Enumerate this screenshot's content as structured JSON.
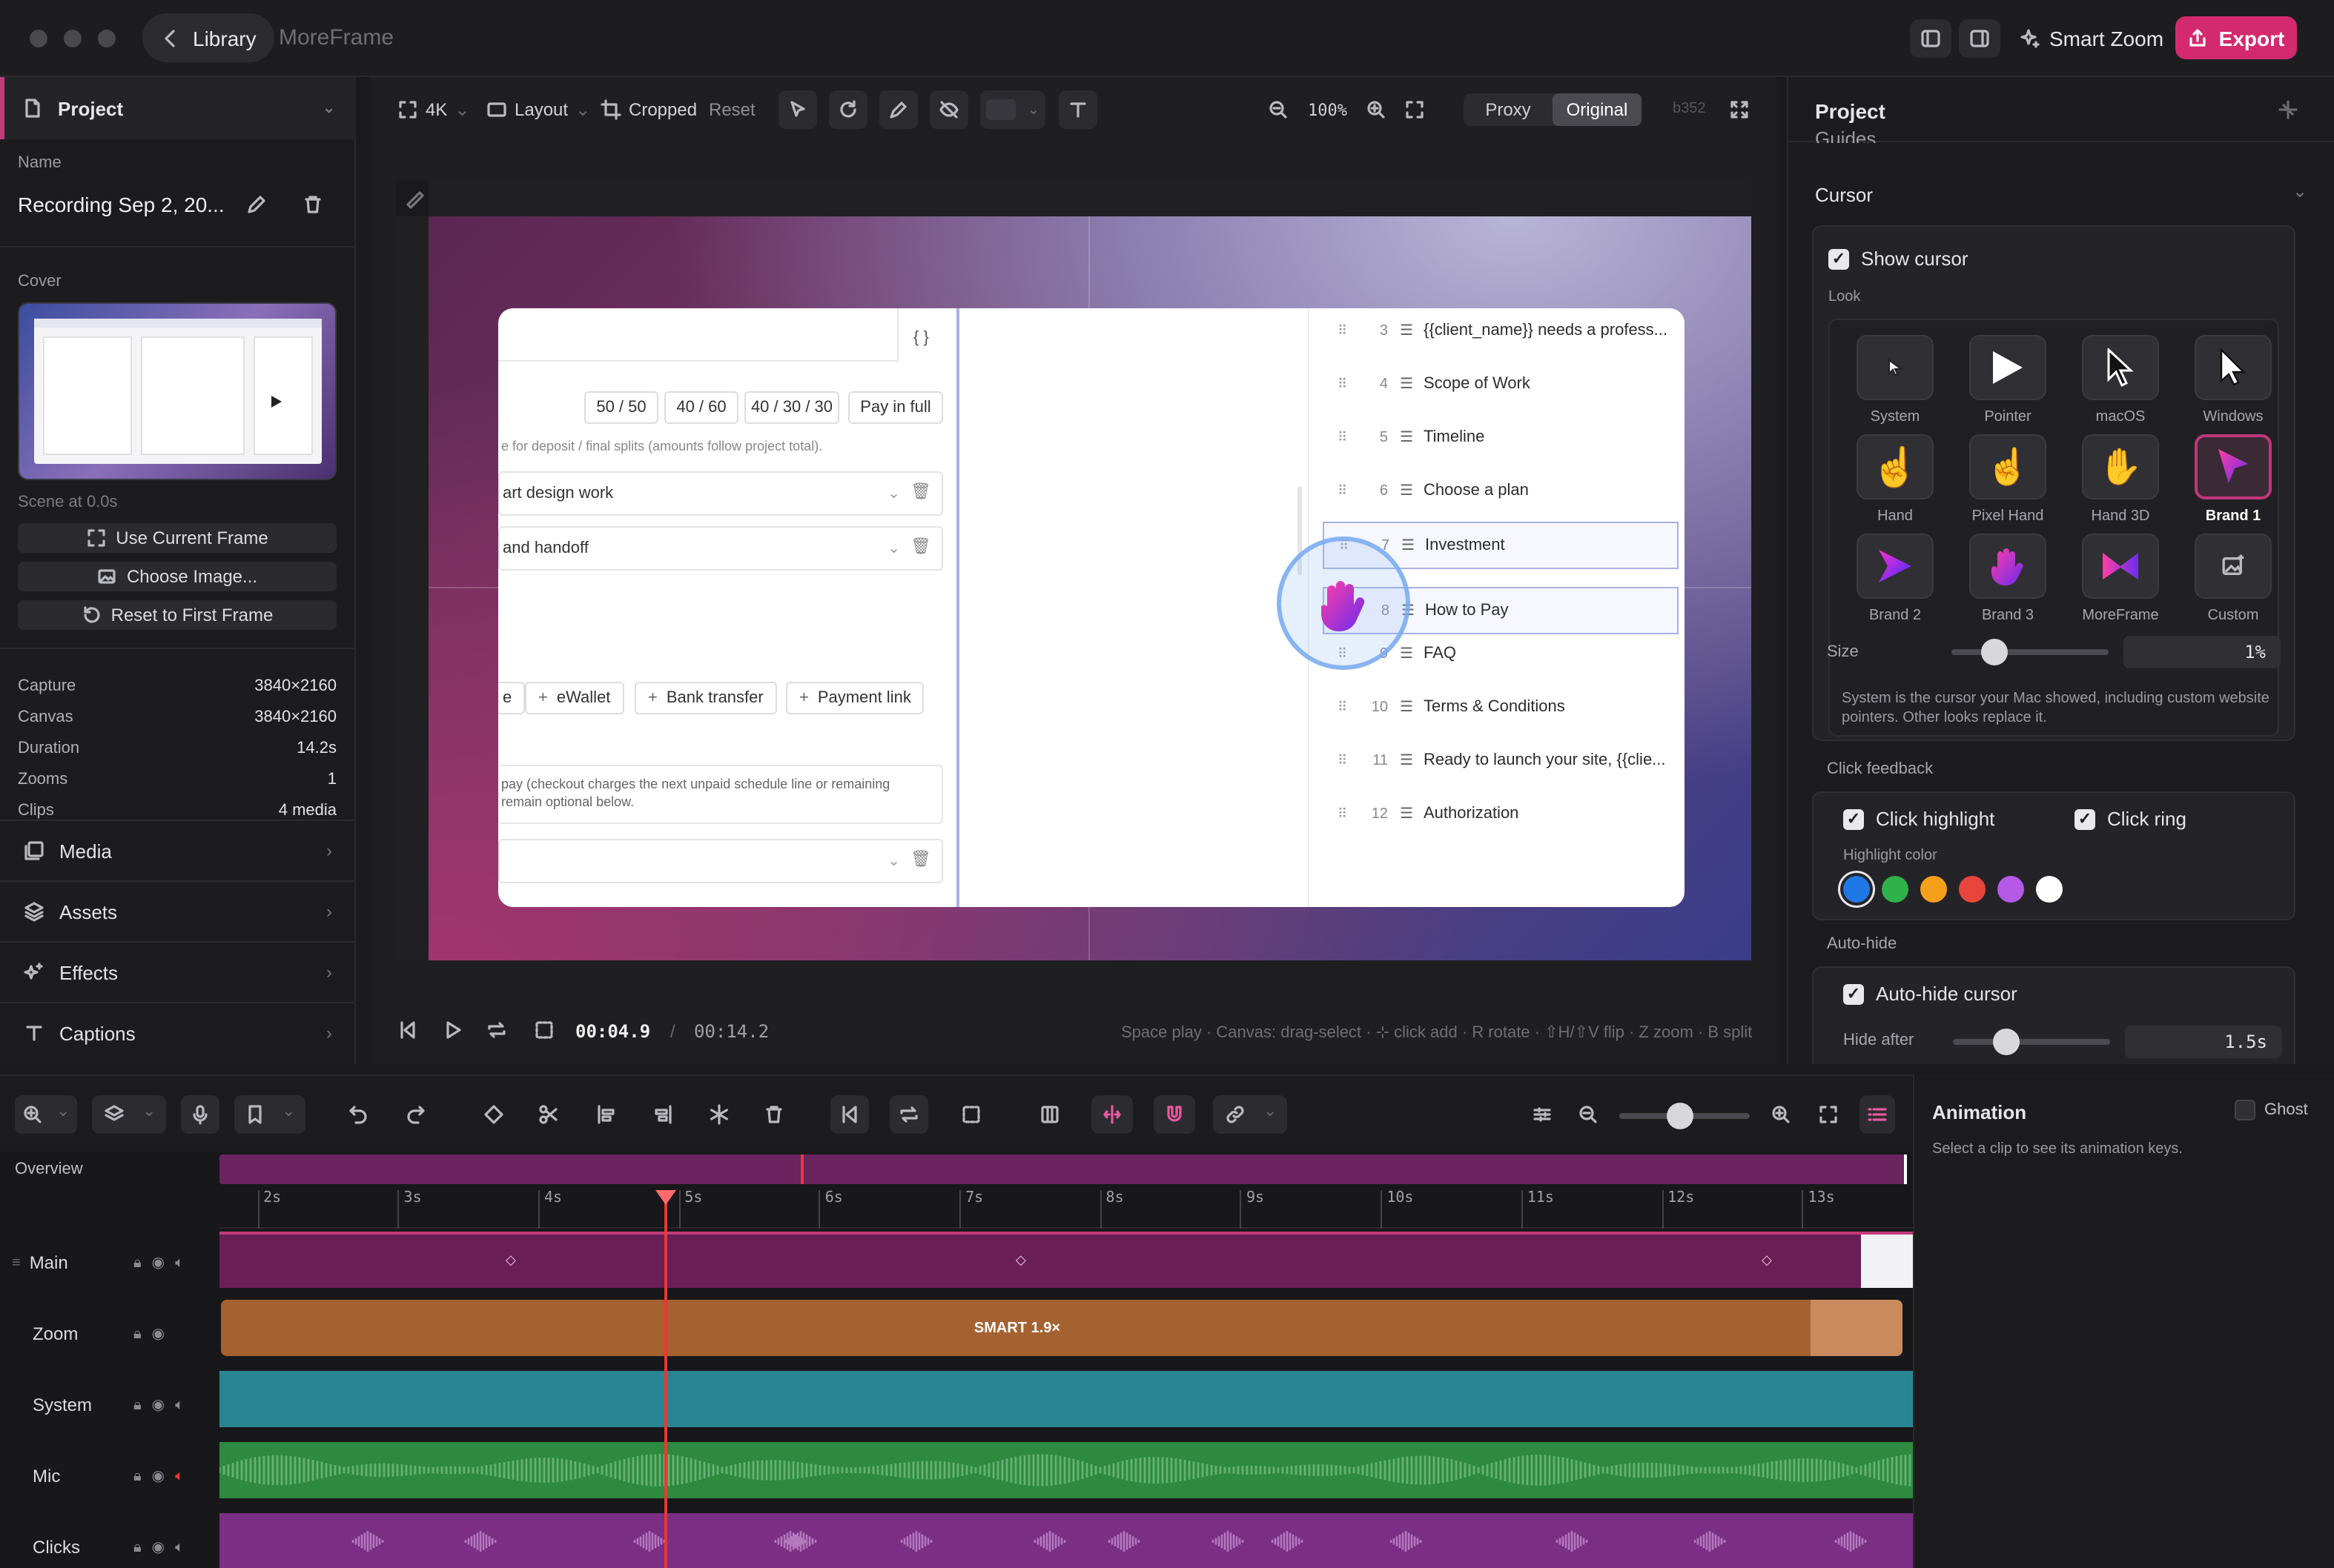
{
  "titlebar": {
    "back_label": "Library",
    "app_name": "MoreFrame",
    "smart_zoom": "Smart Zoom",
    "export": "Export"
  },
  "left": {
    "project_title": "Project",
    "name_label": "Name",
    "name_value": "Recording Sep 2, 20...",
    "cover_label": "Cover",
    "scene_at": "Scene at 0.0s",
    "use_current": "Use Current Frame",
    "choose_image": "Choose Image...",
    "reset_first": "Reset to First Frame",
    "stats": [
      {
        "k": "Capture",
        "v": "3840×2160"
      },
      {
        "k": "Canvas",
        "v": "3840×2160"
      },
      {
        "k": "Duration",
        "v": "14.2s"
      },
      {
        "k": "Zooms",
        "v": "1"
      },
      {
        "k": "Clips",
        "v": "4 media"
      }
    ],
    "sections": [
      "Media",
      "Assets",
      "Effects",
      "Captions"
    ]
  },
  "canvas_toolbar": {
    "resolution": "4K",
    "layout": "Layout",
    "cropped": "Cropped",
    "reset": "Reset",
    "zoom": "100%",
    "proxy": "Proxy",
    "original": "Original",
    "build": "b352"
  },
  "mock": {
    "braces": "{ }",
    "splits": [
      "50 / 50",
      "40 / 60",
      "40 / 30 / 30",
      "Pay in full"
    ],
    "deposit_note": "e for deposit / final splits (amounts follow project total).",
    "field1": "art design work",
    "field2": "and handoff",
    "methods": [
      "e",
      "eWallet",
      "Bank transfer",
      "Payment link"
    ],
    "pay_note_1": "pay (checkout charges the next unpaid schedule line or remaining",
    "pay_note_2": "remain optional below.",
    "sections": [
      {
        "n": "3",
        "t": "{{client_name}} needs a profess..."
      },
      {
        "n": "4",
        "t": "Scope of Work"
      },
      {
        "n": "5",
        "t": "Timeline"
      },
      {
        "n": "6",
        "t": "Choose a plan"
      },
      {
        "n": "7",
        "t": "Investment"
      },
      {
        "n": "8",
        "t": "How to Pay"
      },
      {
        "n": "9",
        "t": "FAQ"
      },
      {
        "n": "10",
        "t": "Terms & Conditions"
      },
      {
        "n": "11",
        "t": "Ready to launch your site, {{clie..."
      },
      {
        "n": "12",
        "t": "Authorization"
      }
    ]
  },
  "playback": {
    "current": "00:04.9",
    "sep": "/",
    "total": "00:14.2",
    "hints": "Space play · Canvas: drag-select · ⊹ click add · R rotate · ⇧H/⇧V flip · Z zoom · B split"
  },
  "right": {
    "title": "Project",
    "guides": "Guides",
    "cursor": "Cursor",
    "show_cursor": "Show cursor",
    "look": "Look",
    "looks": [
      "System",
      "Pointer",
      "macOS",
      "Windows",
      "Hand",
      "Pixel Hand",
      "Hand 3D",
      "Brand 1",
      "Brand 2",
      "Brand 3",
      "MoreFrame",
      "Custom"
    ],
    "selected_look": "Brand 1",
    "size_label": "Size",
    "size_value": "1%",
    "size_level": 0.27,
    "system_note": "System is the cursor your Mac showed, including custom website pointers. Other looks replace it.",
    "click_feedback": "Click feedback",
    "click_highlight": "Click highlight",
    "click_ring": "Click ring",
    "highlight_color": "Highlight color",
    "colors": [
      "#1e78e6",
      "#2fb24a",
      "#f5a01a",
      "#e8453c",
      "#b45ae6",
      "#ffffff"
    ],
    "auto_hide": "Auto-hide",
    "auto_hide_cursor": "Auto-hide cursor",
    "hide_after": "Hide after",
    "hide_value": "1.5s",
    "hide_level": 0.34
  },
  "timeline": {
    "overview": "Overview",
    "ticks": [
      "2s",
      "3s",
      "4s",
      "5s",
      "6s",
      "7s",
      "8s",
      "9s",
      "10s",
      "11s",
      "12s",
      "13s"
    ],
    "tracks": [
      "Main",
      "Zoom",
      "System",
      "Mic",
      "Clicks"
    ],
    "zoom_clip": "SMART 1.9×",
    "playhead_time": 4.9
  },
  "animation": {
    "title": "Animation",
    "ghost": "Ghost",
    "hint": "Select a clip to see its animation keys."
  },
  "colors": {
    "accent": "#d32a6e",
    "main_track": "#6a1e56",
    "zoom_track": "#a5612f",
    "system_track": "#2a8593",
    "mic_track": "#2d8a3e",
    "clicks_track": "#7a2e84",
    "playhead": "#e53935"
  }
}
